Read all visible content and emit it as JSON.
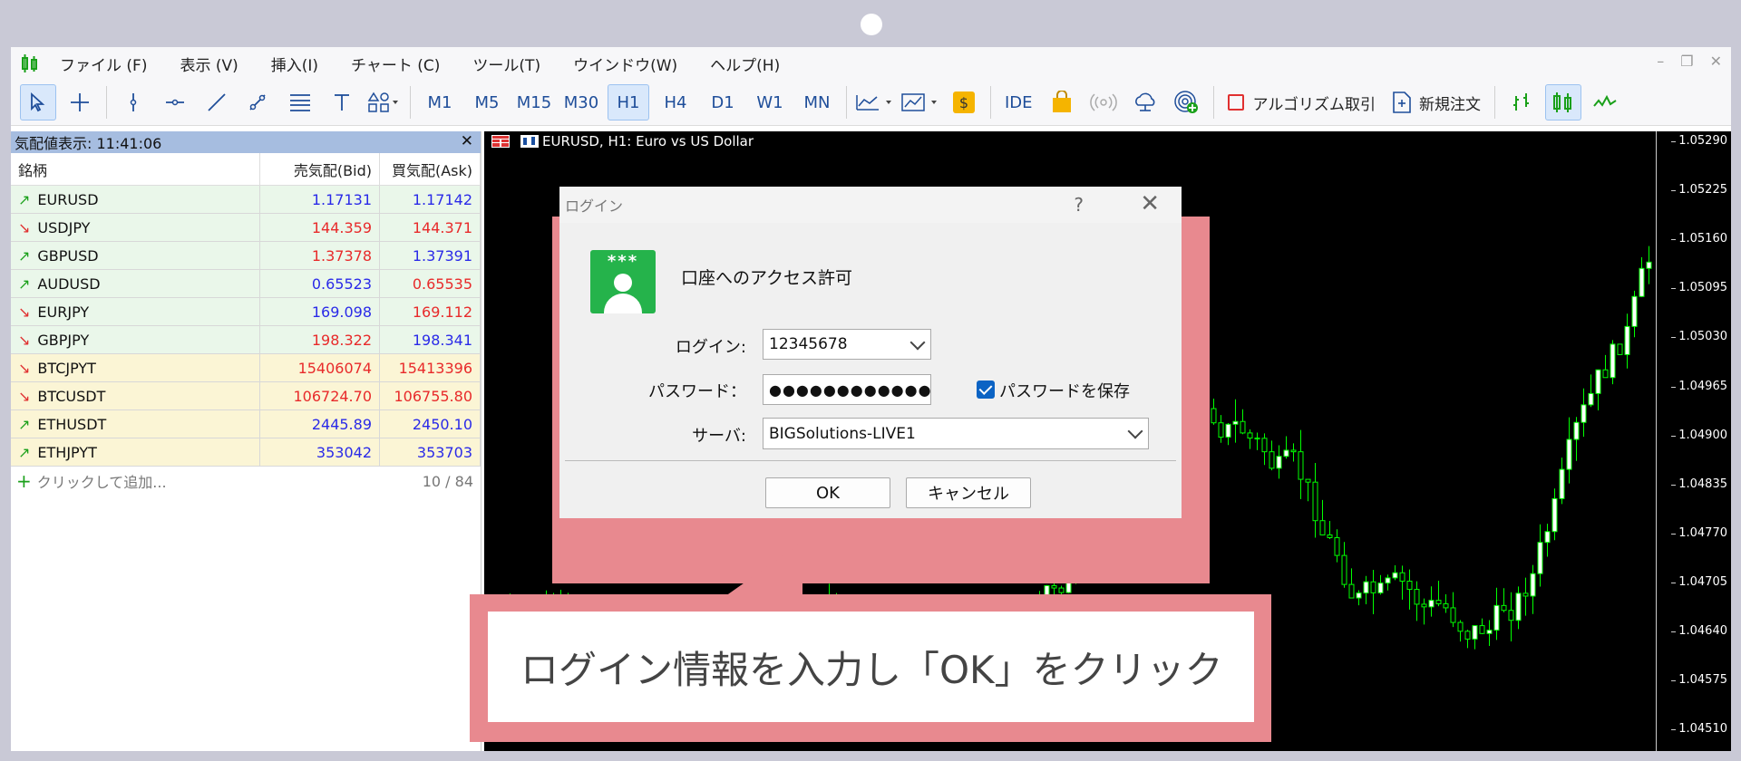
{
  "menu": {
    "items": [
      "ファイル (F)",
      "表示 (V)",
      "挿入(I)",
      "チャート (C)",
      "ツール(T)",
      "ウインドウ(W)",
      "ヘルプ(H)"
    ]
  },
  "toolbar": {
    "timeframes": [
      "M1",
      "M5",
      "M15",
      "M30",
      "H1",
      "H4",
      "D1",
      "W1",
      "MN"
    ],
    "active_timeframe": "H1",
    "ide_label": "IDE",
    "algo_label": "アルゴリズム取引",
    "new_order_label": "新規注文"
  },
  "market_watch": {
    "title": "気配値表示: 11:41:06",
    "columns": [
      "銘柄",
      "売気配(Bid)",
      "買気配(Ask)"
    ],
    "rows": [
      {
        "symbol": "EURUSD",
        "dir": "up",
        "bid": "1.17131",
        "ask": "1.17142",
        "bid_color": "blue",
        "ask_color": "blue",
        "group": "fx"
      },
      {
        "symbol": "USDJPY",
        "dir": "down",
        "bid": "144.359",
        "ask": "144.371",
        "bid_color": "red",
        "ask_color": "red",
        "group": "fx"
      },
      {
        "symbol": "GBPUSD",
        "dir": "up",
        "bid": "1.37378",
        "ask": "1.37391",
        "bid_color": "red",
        "ask_color": "blue",
        "group": "fx"
      },
      {
        "symbol": "AUDUSD",
        "dir": "up",
        "bid": "0.65523",
        "ask": "0.65535",
        "bid_color": "blue",
        "ask_color": "red",
        "group": "fx"
      },
      {
        "symbol": "EURJPY",
        "dir": "down",
        "bid": "169.098",
        "ask": "169.112",
        "bid_color": "blue",
        "ask_color": "red",
        "group": "fx"
      },
      {
        "symbol": "GBPJPY",
        "dir": "down",
        "bid": "198.322",
        "ask": "198.341",
        "bid_color": "red",
        "ask_color": "blue",
        "group": "fx"
      },
      {
        "symbol": "BTCJPYT",
        "dir": "down",
        "bid": "15406074",
        "ask": "15413396",
        "bid_color": "red",
        "ask_color": "red",
        "group": "crypto"
      },
      {
        "symbol": "BTCUSDT",
        "dir": "down",
        "bid": "106724.70",
        "ask": "106755.80",
        "bid_color": "red",
        "ask_color": "red",
        "group": "crypto"
      },
      {
        "symbol": "ETHUSDT",
        "dir": "up",
        "bid": "2445.89",
        "ask": "2450.10",
        "bid_color": "blue",
        "ask_color": "blue",
        "group": "crypto"
      },
      {
        "symbol": "ETHJPYT",
        "dir": "up",
        "bid": "353042",
        "ask": "353703",
        "bid_color": "blue",
        "ask_color": "blue",
        "group": "crypto"
      }
    ],
    "add_label": "クリックして追加...",
    "count": "10 / 84"
  },
  "chart": {
    "title": "EURUSD, H1:  Euro vs US Dollar",
    "price_ticks": [
      "1.05290",
      "1.05225",
      "1.05160",
      "1.05095",
      "1.05030",
      "1.04965",
      "1.04900",
      "1.04835",
      "1.04770",
      "1.04705",
      "1.04640",
      "1.04575",
      "1.04510"
    ]
  },
  "dialog": {
    "title": "ログイン",
    "help": "?",
    "heading": "口座へのアクセス許可",
    "avatar_stars": "***",
    "login_label": "ログイン:",
    "login_value": "12345678",
    "password_label": "パスワード：",
    "password_value": "●●●●●●●●●●●●",
    "save_password_label": "パスワードを保存",
    "server_label": "サーバ:",
    "server_value": "BIGSolutions-LIVE1",
    "ok_label": "OK",
    "cancel_label": "キャンセル"
  },
  "callout": {
    "text": "ログイン情報を入力し「OK」をクリック"
  },
  "colors": {
    "highlight": "#e8898f",
    "up": "#1aa01a",
    "down": "#e03030",
    "candle": "#00ff00"
  }
}
